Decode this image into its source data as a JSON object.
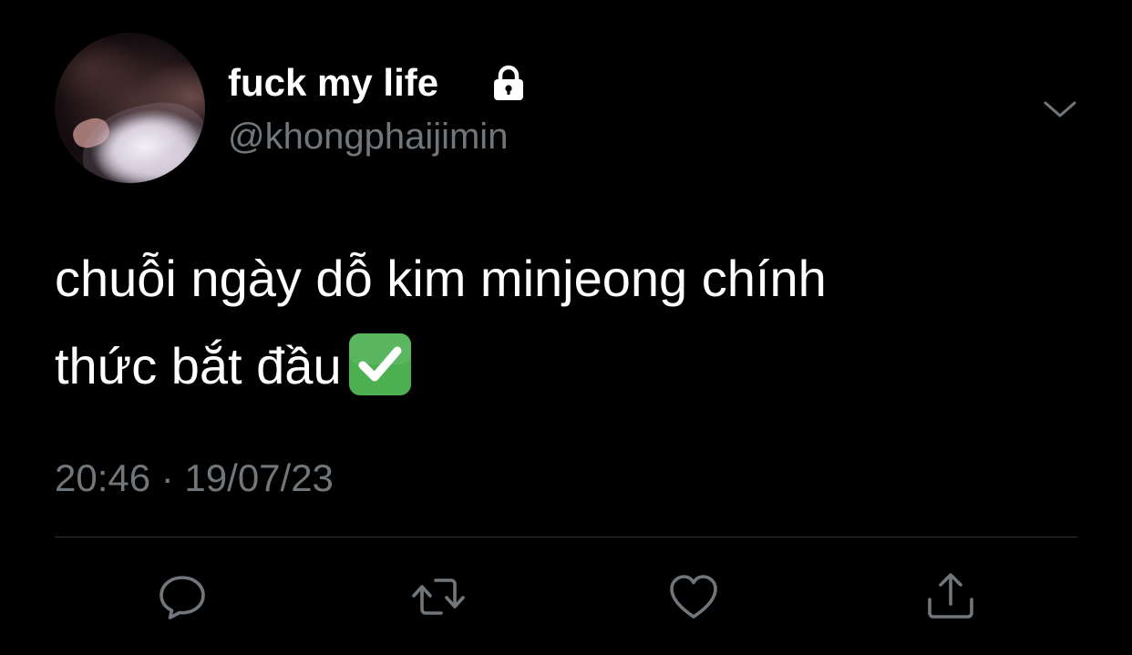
{
  "tweet": {
    "display_name": "fuck my life",
    "handle": "@khongphaijimin",
    "text_line_1": "chuỗi ngày dỗ kim minjeong chính",
    "text_line_2": "thức bắt đầu",
    "emoji": "check-mark-button-emoji",
    "timestamp": "20:46 · 19/07/23"
  },
  "icons": {
    "lock": "lock-icon",
    "menu": "chevron-down-icon",
    "reply": "reply-icon",
    "retweet": "retweet-icon",
    "like": "heart-icon",
    "share": "share-icon"
  },
  "colors": {
    "background": "#000000",
    "primary_text": "#ffffff",
    "secondary_text": "#71767b",
    "divider": "#2f3336",
    "emoji_green": "#4caf50"
  }
}
